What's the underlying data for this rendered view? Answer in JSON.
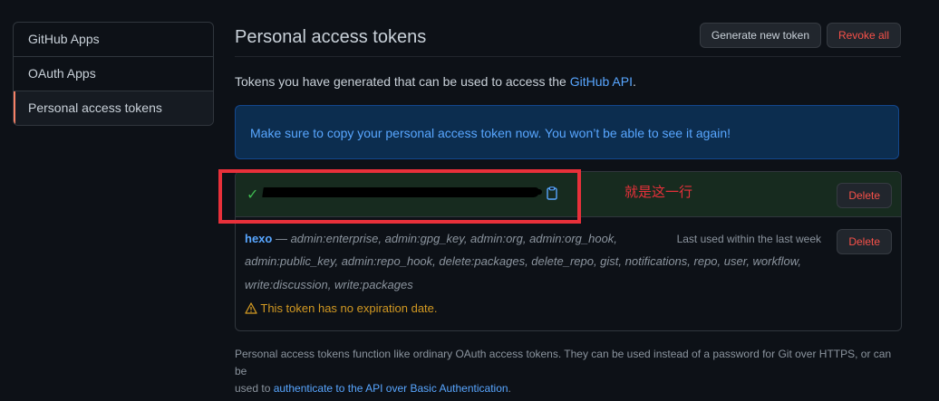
{
  "sidebar": {
    "items": [
      {
        "label": "GitHub Apps"
      },
      {
        "label": "OAuth Apps"
      },
      {
        "label": "Personal access tokens"
      }
    ]
  },
  "header": {
    "title": "Personal access tokens",
    "generate_label": "Generate new token",
    "revoke_label": "Revoke all"
  },
  "intro": {
    "text": "Tokens you have generated that can be used to access the ",
    "link": "GitHub API",
    "suffix": "."
  },
  "flash": {
    "message": "Make sure to copy your personal access token now. You won’t be able to see it again!"
  },
  "new_token": {
    "delete_label": "Delete"
  },
  "token": {
    "name": "hexo",
    "scopes_line1": " — admin:enterprise, admin:gpg_key, admin:org, admin:org_hook,",
    "scopes_line2": "admin:public_key, admin:repo_hook, delete:packages, delete_repo, gist, notifications, repo, user, workflow,",
    "scopes_line3": "write:discussion, write:packages",
    "last_used": "Last used within the last week",
    "warning": "This token has no expiration date.",
    "delete_label": "Delete"
  },
  "annotation": {
    "label": "就是这一行",
    "color": "#e8303a"
  },
  "footer": {
    "text1": "Personal access tokens function like ordinary OAuth access tokens. They can be used instead of a password for Git over HTTPS, or can be",
    "text2": "used to ",
    "link": "authenticate to the API over Basic Authentication",
    "suffix": "."
  },
  "colors": {
    "accent": "#58a6ff",
    "danger": "#f85149",
    "success": "#3fb950",
    "warning": "#d29922",
    "active_indicator": "#f78166"
  },
  "icons": {
    "check": "check-icon",
    "copy": "clipboard-icon",
    "warning": "alert-icon"
  }
}
